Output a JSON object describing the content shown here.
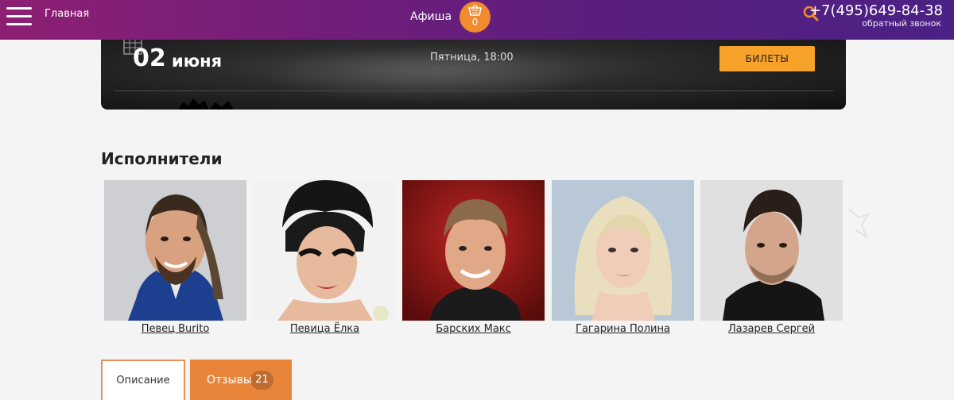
{
  "header": {
    "home_label": "Главная",
    "afisha_label": "Афиша",
    "cart_count": "0",
    "phone": "+7(495)649-84-38",
    "callback_label": "обратный звонок"
  },
  "event": {
    "day": "02",
    "month": "июня",
    "datetime": "Пятница, 18:00",
    "tickets_label": "БИЛЕТЫ"
  },
  "performers_section": {
    "title": "Исполнители",
    "items": [
      {
        "name": "Певец Burito"
      },
      {
        "name": "Певица Ёлка"
      },
      {
        "name": "Барских Макс"
      },
      {
        "name": "Гагарина Полина"
      },
      {
        "name": "Лазарев Сергей"
      }
    ]
  },
  "tabs": {
    "description_label": "Описание",
    "reviews_label": "Отзывы",
    "reviews_count": "21"
  },
  "colors": {
    "header_gradient_start": "#8d1f73",
    "header_gradient_end": "#4b2185",
    "accent_orange": "#f28a2e",
    "tickets_button": "#f6a22a"
  }
}
